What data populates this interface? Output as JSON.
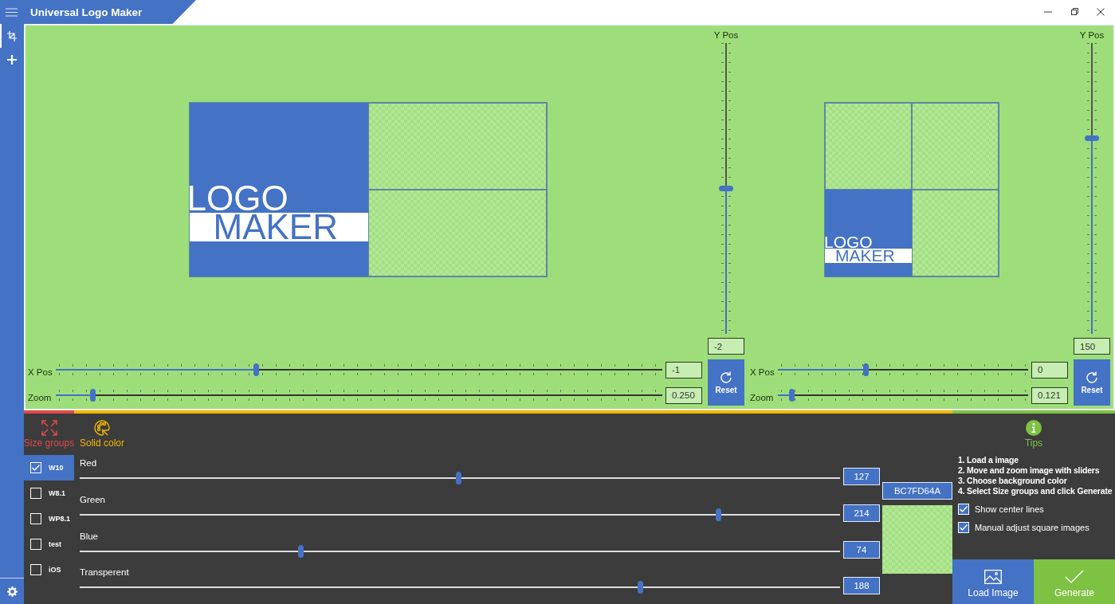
{
  "window": {
    "title": "Universal Logo Maker"
  },
  "rail_items": [
    {
      "kind": "crop",
      "selected": true
    },
    {
      "kind": "add",
      "selected": false
    }
  ],
  "editors": [
    {
      "kind": "wide",
      "logo": [
        "LOGO",
        "MAKER"
      ],
      "y_label": "Y Pos",
      "y_slider": {
        "level": 0.5
      },
      "y_value": "-2",
      "x_label": "X Pos",
      "x_slider": {
        "level": 0.33
      },
      "x_value": "-1",
      "zoom_label": "Zoom",
      "zoom_slider": {
        "level": 0.06
      },
      "zoom_value": "0.250",
      "reset": "Reset"
    },
    {
      "kind": "square",
      "logo": [
        "LOGO",
        "MAKER"
      ],
      "y_label": "Y Pos",
      "y_slider": {
        "level": 0.67
      },
      "y_value": "150",
      "x_label": "X Pos",
      "x_slider": {
        "level": 0.35
      },
      "x_value": "0",
      "zoom_label": "Zoom",
      "zoom_slider": {
        "level": 0.055
      },
      "zoom_value": "0.121",
      "reset": "Reset"
    }
  ],
  "tabs": [
    {
      "kind": "size",
      "label": "Size groups",
      "color": "#e04848"
    },
    {
      "kind": "color",
      "label": "Solid color",
      "color": "#f2b800"
    },
    {
      "kind": "tips",
      "label": "Tips",
      "color": "#7dc242"
    }
  ],
  "size_groups": [
    {
      "label": "W10",
      "checked": true,
      "selected": true
    },
    {
      "label": "W8.1",
      "checked": false,
      "selected": false
    },
    {
      "label": "WP8.1",
      "checked": false,
      "selected": false
    },
    {
      "label": "test",
      "checked": false,
      "selected": false
    },
    {
      "label": "iOS",
      "checked": false,
      "selected": false
    }
  ],
  "color_sliders": [
    {
      "label": "Red",
      "level": 0.498,
      "value": "127"
    },
    {
      "label": "Green",
      "level": 0.84,
      "value": "214"
    },
    {
      "label": "Blue",
      "level": 0.29,
      "value": "74"
    },
    {
      "label": "Transperent",
      "level": 0.737,
      "value": "188"
    }
  ],
  "hex_value": "BC7FD64A",
  "tips": [
    "1. Load a image",
    "2. Move and zoom image with sliders",
    "3. Choose background color",
    "4. Select Size groups and click Generate"
  ],
  "options": [
    {
      "label": "Show center lines",
      "checked": true
    },
    {
      "label": "Manual adjust square images",
      "checked": true
    }
  ],
  "buttons": [
    {
      "kind": "load",
      "label": "Load Image"
    },
    {
      "kind": "generate",
      "label": "Generate"
    }
  ]
}
